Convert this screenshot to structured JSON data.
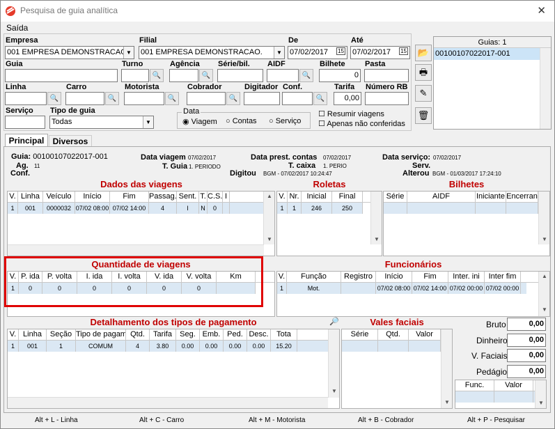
{
  "window": {
    "title": "Pesquisa de guia analítica",
    "menu": "Saída"
  },
  "filters": {
    "empresa_label": "Empresa",
    "empresa_value": "001 EMPRESA DEMONSTRACAO",
    "filial_label": "Filial",
    "filial_value": "001 EMPRESA DEMONSTRACAO.",
    "de_label": "De",
    "de_value": "07/02/2017",
    "ate_label": "Até",
    "ate_value": "07/02/2017",
    "cal": "15",
    "guia_label": "Guia",
    "turno_label": "Turno",
    "agencia_label": "Agência",
    "serie_label": "Série/bil.",
    "aidf_label": "AIDF",
    "bilhete_label": "Bilhete",
    "bilhete_value": "0",
    "pasta_label": "Pasta",
    "linha_label": "Linha",
    "carro_label": "Carro",
    "motorista_label": "Motorista",
    "cobrador_label": "Cobrador",
    "digitador_label": "Digitador",
    "conf_label": "Conf.",
    "tarifa_label": "Tarifa",
    "tarifa_value": "0,00",
    "numero_rb_label": "Número RB",
    "servico_label": "Serviço",
    "tipo_guia_label": "Tipo de guia",
    "tipo_guia_value": "Todas",
    "data_group": "Data",
    "radio_viagem": "Viagem",
    "radio_contas": "Contas",
    "radio_servico": "Serviço",
    "chk_resumir": "Resumir viagens",
    "chk_apenas": "Apenas não conferidas"
  },
  "guias": {
    "header": "Guias: 1",
    "items": [
      "00100107022017-001"
    ]
  },
  "tabs": [
    "Principal",
    "Diversos"
  ],
  "info": {
    "guia_label": "Guia:",
    "guia_value": "00100107022017-001",
    "ag_label": "Ag.",
    "ag_value": "11",
    "conf_label": "Conf.",
    "data_viagem_label": "Data viagem",
    "data_viagem_value": "07/02/2017",
    "tguia_label": "T. Guia",
    "tguia_value": "1. PERIODO",
    "data_prest_label": "Data prest. contas",
    "data_prest_value": "07/02/2017",
    "tcaixa_label": "T. caixa",
    "tcaixa_value": "1. PERIO",
    "digitou_label": "Digitou",
    "digitou_value": "BGM - 07/02/2017 10:24:47",
    "data_serv_label": "Data serviço:",
    "data_serv_value": "07/02/2017",
    "serv_label": "Serv.",
    "alterou_label": "Alterou",
    "alterou_value": "BGM - 01/03/2017 17:24:10"
  },
  "viagens": {
    "title": "Dados das viagens",
    "cols": [
      "V.",
      "Linha",
      "Veículo",
      "Início",
      "Fim",
      "Passag.",
      "Sent.",
      "T.",
      "C.S.",
      "I"
    ],
    "row": [
      "1",
      "001",
      "0000032",
      "07/02 08:00",
      "07/02 14:00",
      "4",
      "I",
      "N",
      "0",
      ""
    ]
  },
  "roletas": {
    "title": "Roletas",
    "cols": [
      "V.",
      "Nr.",
      "Inicial",
      "Final"
    ],
    "row": [
      "1",
      "1",
      "246",
      "250"
    ]
  },
  "bilhetes": {
    "title": "Bilhetes",
    "cols": [
      "Série",
      "AIDF",
      "Iniciante",
      "Encerran"
    ]
  },
  "quantidade": {
    "title": "Quantidade de viagens",
    "cols": [
      "V.",
      "P. ida",
      "P. volta",
      "I. ida",
      "I. volta",
      "V. ida",
      "V. volta",
      "Km"
    ],
    "row": [
      "1",
      "0",
      "0",
      "0",
      "0",
      "0",
      "0",
      ""
    ]
  },
  "funcionarios": {
    "title": "Funcionários",
    "cols": [
      "V.",
      "Função",
      "Registro",
      "Início",
      "Fim",
      "Inter. ini",
      "Inter fim"
    ],
    "row": [
      "1",
      "Mot.",
      "",
      "07/02 08:00",
      "07/02 14:00",
      "07/02 00:00",
      "07/02 00:00"
    ]
  },
  "pagamento": {
    "title": "Detalhamento dos tipos de pagamento",
    "cols": [
      "V.",
      "Linha",
      "Seção",
      "Tipo de pagamento",
      "Qtd.",
      "Tarifa",
      "Seg.",
      "Emb.",
      "Ped.",
      "Desc.",
      "Tota"
    ],
    "row": [
      "1",
      "001",
      "1",
      "COMUM",
      "4",
      "3.80",
      "0.00",
      "0.00",
      "0.00",
      "0.00",
      "15.20"
    ]
  },
  "vales": {
    "title": "Vales faciais",
    "cols": [
      "Série",
      "Qtd.",
      "Valor"
    ]
  },
  "totais": {
    "bruto_label": "Bruto",
    "bruto": "0,00",
    "dinheiro_label": "Dinheiro",
    "dinheiro": "0,00",
    "vfaciais_label": "V. Faciais",
    "vfaciais": "0,00",
    "pedagio_label": "Pedágio",
    "pedagio": "0,00",
    "func_col": "Func.",
    "valor_col": "Valor"
  },
  "status": [
    "Alt + L - Linha",
    "Alt + C - Carro",
    "Alt + M - Motorista",
    "Alt + B - Cobrador",
    "Alt + P - Pesquisar"
  ],
  "colors": {
    "section_title": "#c00000",
    "highlight_box": "#e00000",
    "row_bg": "#dbe8f4",
    "selected_item": "#cce4f7"
  }
}
